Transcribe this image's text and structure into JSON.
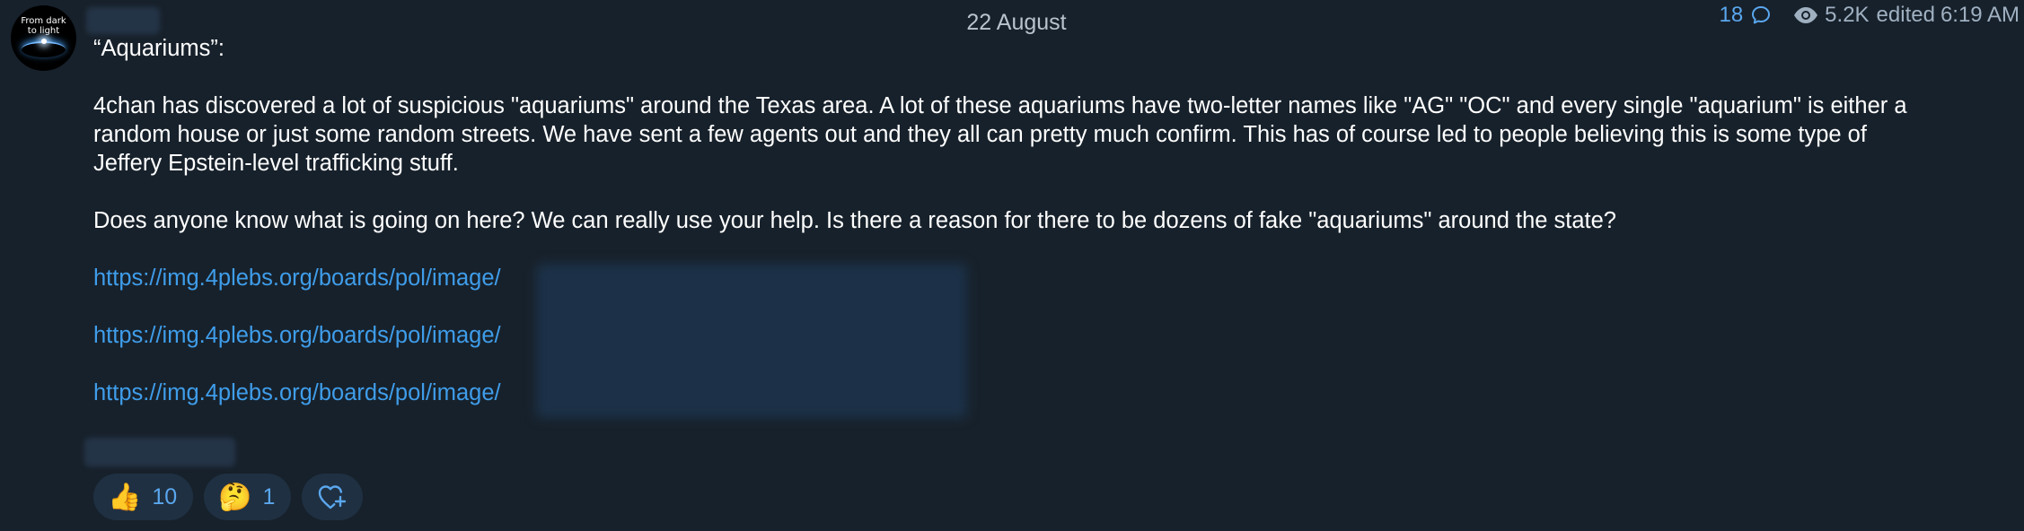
{
  "channel": {
    "avatar_text": [
      "From dark",
      "to light"
    ]
  },
  "date_separator": "22 August",
  "meta": {
    "comments": "18",
    "views": "5.2K",
    "edited": "edited",
    "time": "6:19 AM",
    "icons": [
      "comment-icon",
      "eye-icon"
    ]
  },
  "message": {
    "title": "“Aquariums”:",
    "paragraph1": "4chan has discovered a lot of suspicious \"aquariums\" around the Texas area. A lot of these aquariums have two-letter names like \"AG\" \"OC\" and every single \"aquarium\" is either a random house or just some random streets. We have sent a few agents out and they all can pretty much confirm. This has of course led to people believing this is some type of Jeffery Epstein-level trafficking stuff.",
    "paragraph2": "Does anyone know what is going on here? We can really use your help. Is there a reason for there to be dozens of fake \"aquariums\" around the state?",
    "links": [
      "https://img.4plebs.org/boards/pol/image/",
      "https://img.4plebs.org/boards/pol/image/",
      "https://img.4plebs.org/boards/pol/image/"
    ]
  },
  "reactions": [
    {
      "emoji": "👍",
      "count": "10"
    },
    {
      "emoji": "🤔",
      "count": "1"
    }
  ],
  "colors": {
    "background": "#17212b",
    "link": "#3f9dea",
    "accent": "#5aa7ee",
    "meta": "#9fb0c1"
  }
}
